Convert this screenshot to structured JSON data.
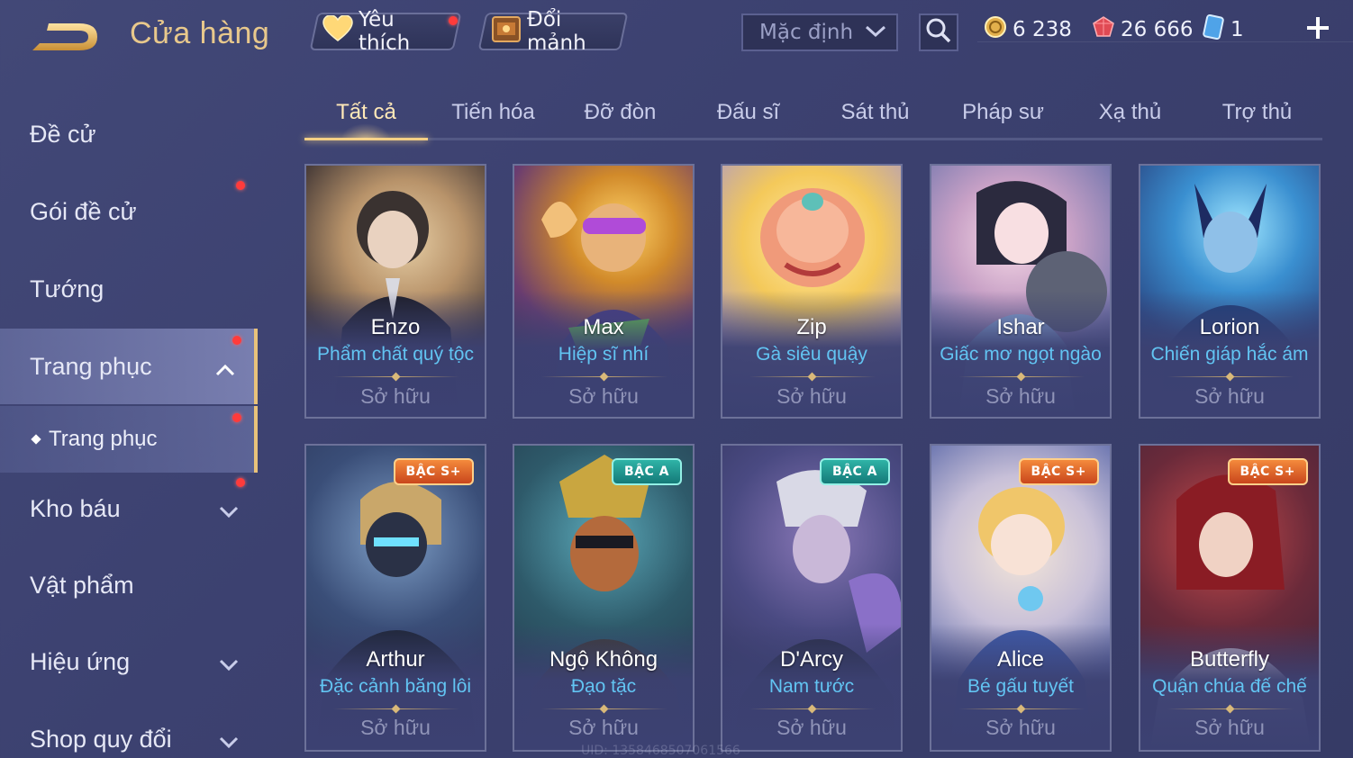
{
  "header": {
    "title": "Cửa hàng",
    "favorites_label": "Yêu thích",
    "exchange_label": "Đổi mảnh",
    "sort_value": "Mặc định",
    "currency_gold": "6 238",
    "currency_gem": "26 666",
    "currency_card": "1"
  },
  "sidebar": {
    "items": [
      {
        "label": "Đề cử"
      },
      {
        "label": "Gói đề cử"
      },
      {
        "label": "Tướng"
      },
      {
        "label": "Trang phục"
      },
      {
        "label": "Kho báu"
      },
      {
        "label": "Vật phẩm"
      },
      {
        "label": "Hiệu ứng"
      },
      {
        "label": "Shop quy đổi"
      }
    ],
    "sub_item": "Trang phục"
  },
  "tabs": [
    "Tất cả",
    "Tiến hóa",
    "Đỡ đòn",
    "Đấu sĩ",
    "Sát thủ",
    "Pháp sư",
    "Xạ thủ",
    "Trợ thủ"
  ],
  "cards": [
    {
      "hero": "Enzo",
      "skin": "Phẩm chất quý tộc",
      "status": "Sở hữu",
      "tier": ""
    },
    {
      "hero": "Max",
      "skin": "Hiệp sĩ nhí",
      "status": "Sở hữu",
      "tier": ""
    },
    {
      "hero": "Zip",
      "skin": "Gà siêu quậy",
      "status": "Sở hữu",
      "tier": ""
    },
    {
      "hero": "Ishar",
      "skin": "Giấc mơ ngọt ngào",
      "status": "Sở hữu",
      "tier": ""
    },
    {
      "hero": "Lorion",
      "skin": "Chiến giáp hắc ám",
      "status": "Sở hữu",
      "tier": ""
    },
    {
      "hero": "Arthur",
      "skin": "Đặc cảnh băng lôi",
      "status": "Sở hữu",
      "tier": "BẬC S+"
    },
    {
      "hero": "Ngộ Không",
      "skin": "Đạo tặc",
      "status": "Sở hữu",
      "tier": "BẬC A"
    },
    {
      "hero": "D'Arcy",
      "skin": "Nam tước",
      "status": "Sở hữu",
      "tier": "BẬC A"
    },
    {
      "hero": "Alice",
      "skin": "Bé gấu tuyết",
      "status": "Sở hữu",
      "tier": "BẬC S+"
    },
    {
      "hero": "Butterfly",
      "skin": "Quận chúa đế chế",
      "status": "Sở hữu",
      "tier": "BẬC S+"
    }
  ],
  "uid": "UID: 1358468507061566",
  "colors": {
    "accent_gold": "#e8c88c",
    "skin_name_blue": "#62c4f2",
    "notification_red": "#ff3b3b"
  }
}
